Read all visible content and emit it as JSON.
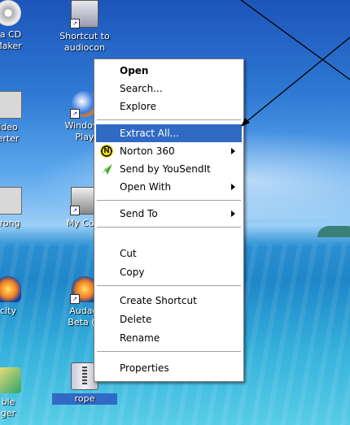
{
  "desktop_icons": {
    "cd_maker": "ca CD\nMaker",
    "shortcut_audio": "Shortcut to\naudiocon",
    "video_converter": "ideo\nerter",
    "windows_media": "Windows\nPlay",
    "strong": "trong",
    "my_computer": "My Com",
    "audacity": "city",
    "audacity_beta": "Audaci\nBeta (U",
    "bottom_left": "ble\nger",
    "rope": "rope"
  },
  "context_menu": {
    "open": "Open",
    "search": "Search...",
    "explore": "Explore",
    "extract_all": "Extract All...",
    "norton": "Norton 360",
    "send_by_yousendit": "Send by YouSendIt",
    "open_with": "Open With",
    "send_to": "Send To",
    "cut": "Cut",
    "copy": "Copy",
    "create_shortcut": "Create Shortcut",
    "delete": "Delete",
    "rename": "Rename",
    "properties": "Properties",
    "highlight_color": "#316ac5"
  },
  "icons": {
    "norton_glyph": "N"
  }
}
